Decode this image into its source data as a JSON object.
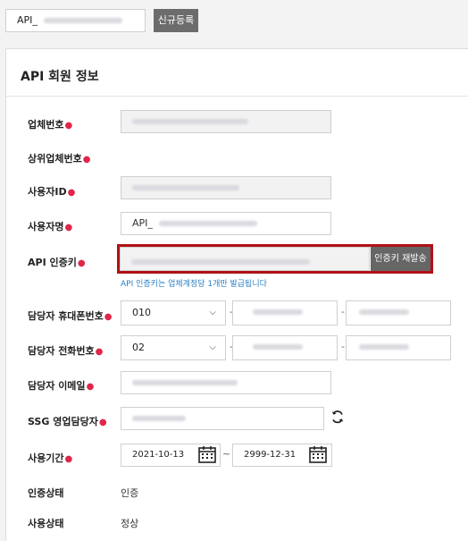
{
  "topbar": {
    "api_prefix": "API_",
    "new_button": "신규등록"
  },
  "panel": {
    "title": "API 회원 정보"
  },
  "form": {
    "company_no": {
      "label": "업체번호"
    },
    "parent_company_no": {
      "label": "상위업체번호"
    },
    "user_id": {
      "label": "사용자ID"
    },
    "user_name": {
      "label": "사용자명",
      "prefix": "API_"
    },
    "api_key": {
      "label": "API 인증키",
      "resend_button": "인증키 재발송",
      "helper": "API 인증키는 업체계정당 1개만 발급됩니다"
    },
    "mobile": {
      "label": "담당자 휴대폰번호",
      "selected": "010",
      "dash": "-"
    },
    "phone": {
      "label": "담당자 전화번호",
      "selected": "02",
      "dash": "-"
    },
    "email": {
      "label": "담당자 이메일"
    },
    "ssg_manager": {
      "label": "SSG 영업담당자"
    },
    "period": {
      "label": "사용기간",
      "start": "2021-10-13",
      "separator": "~",
      "end": "2999-12-31"
    },
    "auth_status": {
      "label": "인증상태",
      "value": "인증"
    },
    "use_status": {
      "label": "사용상태",
      "value": "정상"
    },
    "required_mark": "●"
  },
  "colors": {
    "required": "#e0264a",
    "highlight_border": "#b01116",
    "button_bg": "#666666",
    "helper_text": "#2a7fc4"
  },
  "icons": {
    "calendar": "calendar-icon",
    "refresh": "refresh-icon",
    "chevron": "chevron-down-icon"
  }
}
